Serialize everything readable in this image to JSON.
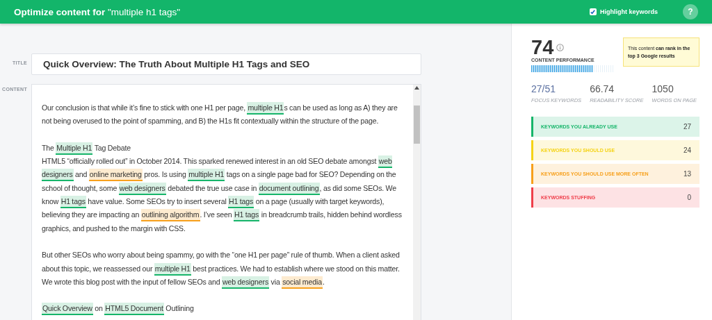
{
  "header": {
    "title": "**Optimize content for** \"multiple h1 tags\"",
    "highlight": {
      "label": "Highlight keywords",
      "checked": true
    },
    "help": "?"
  },
  "editor": {
    "title_label": "TITLE",
    "title_value": "Quick Overview: The Truth About Multiple H1 Tags and SEO",
    "content_label": "CONTENT",
    "blocks": [
      {
        "lines": [
          [
            {
              "kind": "plain",
              "text": "Our conclusion is that while it’s fine to stick with one H1 per page, "
            },
            {
              "kind": "used",
              "text": "multiple H1"
            },
            {
              "kind": "plain",
              "text": "s can be used as long as A) they are not being overused to the point of spamming, and B) the H1s fit contextually within the structure of the page."
            }
          ]
        ]
      },
      {
        "lines": [
          [
            {
              "kind": "plain",
              "text": "The "
            },
            {
              "kind": "used",
              "text": "Multiple H1"
            },
            {
              "kind": "plain",
              "text": " Tag Debate"
            }
          ],
          [
            {
              "kind": "plain",
              "text": "HTML5 “officially rolled out” in October 2014. This sparked renewed interest in an old SEO debate amongst "
            },
            {
              "kind": "used",
              "text": "web designers"
            },
            {
              "kind": "plain",
              "text": " and "
            },
            {
              "kind": "often",
              "text": "online marketing"
            },
            {
              "kind": "plain",
              "text": " pros. Is using "
            },
            {
              "kind": "used",
              "text": "multiple H1"
            },
            {
              "kind": "plain",
              "text": " tags on a single page bad for SEO? Depending on the school of thought, some "
            },
            {
              "kind": "used",
              "text": "web designers"
            },
            {
              "kind": "plain",
              "text": " debated the true use case in "
            },
            {
              "kind": "used",
              "text": "document outlining"
            },
            {
              "kind": "plain",
              "text": ", as did some SEOs. We know "
            },
            {
              "kind": "used",
              "text": "H1 tags"
            },
            {
              "kind": "plain",
              "text": " have value. Some SEOs try to insert several "
            },
            {
              "kind": "used",
              "text": "H1 tags"
            },
            {
              "kind": "plain",
              "text": " on a page (usually with target keywords), believing they are impacting an "
            },
            {
              "kind": "often",
              "text": "outlining algorithm"
            },
            {
              "kind": "plain",
              "text": ". I’ve seen "
            },
            {
              "kind": "used",
              "text": "H1 tags"
            },
            {
              "kind": "plain",
              "text": " in breadcrumb trails, hidden behind wordless graphics, and pushed to the margin with CSS."
            }
          ]
        ]
      },
      {
        "lines": [
          [
            {
              "kind": "plain",
              "text": "But other SEOs who worry about being spammy, go with the “one H1 per page” rule of thumb. When a client asked about this topic, we reassessed our "
            },
            {
              "kind": "used",
              "text": "multiple H1"
            },
            {
              "kind": "plain",
              "text": " best practices. We had to establish where we stood on this matter. We wrote this blog post with the input of fellow SEOs and "
            },
            {
              "kind": "used",
              "text": "web designers"
            },
            {
              "kind": "plain",
              "text": " via "
            },
            {
              "kind": "often",
              "text": "social media"
            },
            {
              "kind": "plain",
              "text": "."
            }
          ]
        ]
      },
      {
        "lines": [
          [
            {
              "kind": "used",
              "text": "Quick Overview"
            },
            {
              "kind": "plain",
              "text": " on "
            },
            {
              "kind": "used",
              "text": "HTML5 Document"
            },
            {
              "kind": "plain",
              "text": " Outlining"
            }
          ]
        ]
      }
    ]
  },
  "score": {
    "value": "74",
    "label": "CONTENT PERFORMANCE",
    "level": 0.74,
    "tooltip": "This content **can rank in the top 3 Google results**"
  },
  "stats": [
    {
      "value": "27/51",
      "label": "FOCUS KEYWORDS",
      "kind": "focus"
    },
    {
      "value": "66.74",
      "label": "READABILITY SCORE",
      "kind": "plain"
    },
    {
      "value": "1050",
      "label": "WORDS ON PAGE",
      "kind": "plain"
    }
  ],
  "keyword_groups": [
    {
      "label": "KEYWORDS YOU ALREADY USE",
      "count": "27",
      "color": "#16b56a"
    },
    {
      "label": "KEYWORDS YOU SHOULD USE",
      "count": "24",
      "color": "#f5d315"
    },
    {
      "label": "KEYWORDS YOU SHOULD USE MORE OFTEN",
      "count": "13",
      "color": "#f7a01c"
    },
    {
      "label": "KEYWORDS STUFFING",
      "count": "0",
      "color": "#ef3e4a"
    }
  ]
}
